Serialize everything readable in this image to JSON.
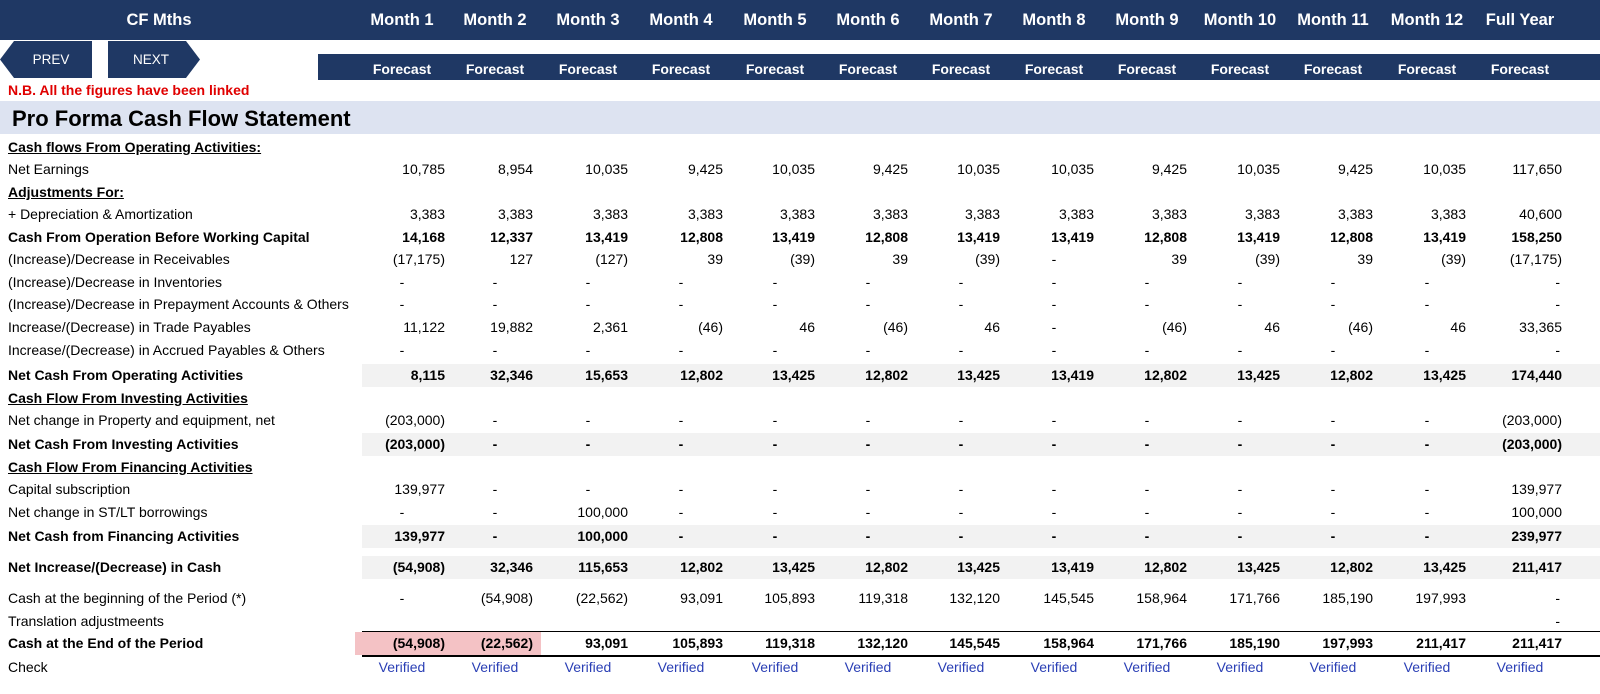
{
  "header": {
    "sheet_title": "CF Mths",
    "months": [
      "Month 1",
      "Month 2",
      "Month 3",
      "Month 4",
      "Month 5",
      "Month 6",
      "Month 7",
      "Month 8",
      "Month 9",
      "Month 10",
      "Month 11",
      "Month 12",
      "Full Year"
    ],
    "forecast_label": "Forecast"
  },
  "nav": {
    "prev_label": "PREV",
    "next_label": "NEXT"
  },
  "note": "N.B. All the figures have been linked",
  "title": "Pro Forma Cash Flow Statement",
  "rows": [
    {
      "label": "Cash flows From Operating Activities:",
      "style": "head",
      "values": []
    },
    {
      "label": "Net Earnings",
      "style": "normal",
      "values": [
        "10,785",
        "8,954",
        "10,035",
        "9,425",
        "10,035",
        "9,425",
        "10,035",
        "10,035",
        "9,425",
        "10,035",
        "9,425",
        "10,035",
        "117,650"
      ]
    },
    {
      "label": "Adjustments For:",
      "style": "head",
      "values": []
    },
    {
      "label": " + Depreciation & Amortization",
      "style": "normal",
      "values": [
        "3,383",
        "3,383",
        "3,383",
        "3,383",
        "3,383",
        "3,383",
        "3,383",
        "3,383",
        "3,383",
        "3,383",
        "3,383",
        "3,383",
        "40,600"
      ]
    },
    {
      "label": "Cash From Operation Before Working Capital",
      "style": "bold",
      "values": [
        "14,168",
        "12,337",
        "13,419",
        "12,808",
        "13,419",
        "12,808",
        "13,419",
        "13,419",
        "12,808",
        "13,419",
        "12,808",
        "13,419",
        "158,250"
      ]
    },
    {
      "label": "(Increase)/Decrease in Receivables",
      "style": "normal",
      "values": [
        "(17,175)",
        "127",
        "(127)",
        "39",
        "(39)",
        "39",
        "(39)",
        "-",
        "39",
        "(39)",
        "39",
        "(39)",
        "(17,175)"
      ]
    },
    {
      "label": "(Increase)/Decrease in Inventories",
      "style": "normal",
      "values": [
        "-",
        "-",
        "-",
        "-",
        "-",
        "-",
        "-",
        "-",
        "-",
        "-",
        "-",
        "-",
        "-"
      ]
    },
    {
      "label": "(Increase)/Decrease in Prepayment Accounts & Others",
      "style": "normal",
      "values": [
        "-",
        "-",
        "-",
        "-",
        "-",
        "-",
        "-",
        "-",
        "-",
        "-",
        "-",
        "-",
        "-"
      ]
    },
    {
      "label": "Increase/(Decrease) in Trade Payables",
      "style": "normal",
      "values": [
        "11,122",
        "19,882",
        "2,361",
        "(46)",
        "46",
        "(46)",
        "46",
        "-",
        "(46)",
        "46",
        "(46)",
        "46",
        "33,365"
      ]
    },
    {
      "label": "Increase/(Decrease) in Accrued Payables & Others",
      "style": "normal",
      "values": [
        "-",
        "-",
        "-",
        "-",
        "-",
        "-",
        "-",
        "-",
        "-",
        "-",
        "-",
        "-",
        "-"
      ]
    },
    {
      "label": "Net Cash From Operating Activities",
      "style": "total",
      "values": [
        "8,115",
        "32,346",
        "15,653",
        "12,802",
        "13,425",
        "12,802",
        "13,425",
        "13,419",
        "12,802",
        "13,425",
        "12,802",
        "13,425",
        "174,440"
      ]
    },
    {
      "label": "Cash Flow From Investing Activities",
      "style": "head",
      "values": []
    },
    {
      "label": "Net change in Property and equipment, net",
      "style": "normal",
      "values": [
        "(203,000)",
        "-",
        "-",
        "-",
        "-",
        "-",
        "-",
        "-",
        "-",
        "-",
        "-",
        "-",
        "(203,000)"
      ]
    },
    {
      "label": "Net Cash From Investing Activities",
      "style": "total",
      "values": [
        "(203,000)",
        "-",
        "-",
        "-",
        "-",
        "-",
        "-",
        "-",
        "-",
        "-",
        "-",
        "-",
        "(203,000)"
      ]
    },
    {
      "label": "Cash Flow From Financing Activities",
      "style": "head",
      "values": []
    },
    {
      "label": "Capital subscription",
      "style": "normal",
      "values": [
        "139,977",
        "-",
        "-",
        "-",
        "-",
        "-",
        "-",
        "-",
        "-",
        "-",
        "-",
        "-",
        "139,977"
      ]
    },
    {
      "label": "Net change in ST/LT borrowings",
      "style": "normal",
      "values": [
        "-",
        "-",
        "100,000",
        "-",
        "-",
        "-",
        "-",
        "-",
        "-",
        "-",
        "-",
        "-",
        "100,000"
      ]
    },
    {
      "label": "Net Cash from Financing Activities",
      "style": "total",
      "values": [
        "139,977",
        "-",
        "100,000",
        "-",
        "-",
        "-",
        "-",
        "-",
        "-",
        "-",
        "-",
        "-",
        "239,977"
      ]
    },
    {
      "label": "Net Increase/(Decrease) in Cash",
      "style": "total",
      "values": [
        "(54,908)",
        "32,346",
        "115,653",
        "12,802",
        "13,425",
        "12,802",
        "13,425",
        "13,419",
        "12,802",
        "13,425",
        "12,802",
        "13,425",
        "211,417"
      ]
    },
    {
      "label": "Cash at the beginning of the Period (*)",
      "style": "normal",
      "values": [
        "-",
        "(54,908)",
        "(22,562)",
        "93,091",
        "105,893",
        "119,318",
        "132,120",
        "145,545",
        "158,964",
        "171,766",
        "185,190",
        "197,993",
        "-"
      ]
    },
    {
      "label": "Translation adjustmeents",
      "style": "normal",
      "values": [
        "",
        "",
        "",
        "",
        "",
        "",
        "",
        "",
        "",
        "",
        "",
        "",
        "-"
      ]
    },
    {
      "label": "Cash at the End of the Period",
      "style": "end",
      "values": [
        "(54,908)",
        "(22,562)",
        "93,091",
        "105,893",
        "119,318",
        "132,120",
        "145,545",
        "158,964",
        "171,766",
        "185,190",
        "197,993",
        "211,417",
        "211,417"
      ]
    },
    {
      "label": "Check",
      "style": "check",
      "values": [
        "Verified",
        "Verified",
        "Verified",
        "Verified",
        "Verified",
        "Verified",
        "Verified",
        "Verified",
        "Verified",
        "Verified",
        "Verified",
        "Verified",
        "Verified"
      ]
    }
  ],
  "colors": {
    "header_bg": "#1f3864",
    "title_bg": "#dde3f1",
    "shade_bg": "#f2f2f2",
    "note": "#e00000",
    "negative_highlight": "#f4c2c5",
    "verified": "#2a3fb5"
  }
}
